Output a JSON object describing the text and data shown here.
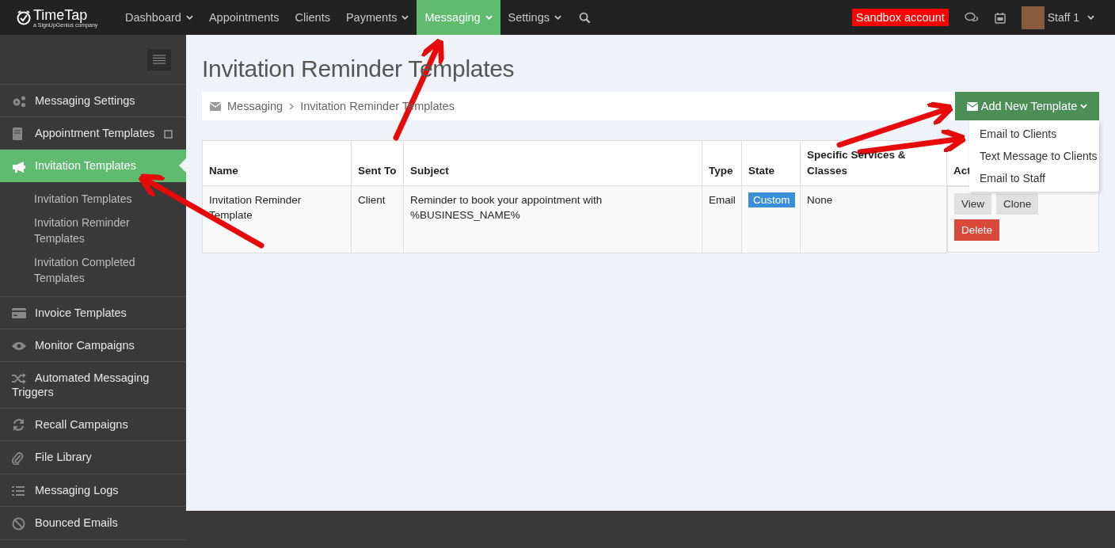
{
  "topbar": {
    "logo": "TimeTap",
    "logo_tagline": "a SignUpGenius company",
    "nav": [
      {
        "label": "Dashboard",
        "has_menu": true,
        "selected": false
      },
      {
        "label": "Appointments",
        "has_menu": false,
        "selected": false
      },
      {
        "label": "Clients",
        "has_menu": false,
        "selected": false
      },
      {
        "label": "Payments",
        "has_menu": true,
        "selected": false
      },
      {
        "label": "Messaging",
        "has_menu": true,
        "selected": true
      },
      {
        "label": "Settings",
        "has_menu": true,
        "selected": false
      }
    ],
    "sandbox_badge": "Sandbox account",
    "user": "Staff 1"
  },
  "sidebar": {
    "items": [
      {
        "label": "Messaging Settings",
        "selected": false
      },
      {
        "label": "Appointment Templates",
        "selected": false
      },
      {
        "label": "Invitation Templates",
        "selected": true,
        "children": [
          {
            "label": "Invitation Templates"
          },
          {
            "label": "Invitation Reminder Templates"
          },
          {
            "label": "Invitation Completed Templates"
          }
        ]
      },
      {
        "label": "Invoice Templates",
        "selected": false
      },
      {
        "label": "Monitor Campaigns",
        "selected": false
      },
      {
        "label": "Automated Messaging Triggers",
        "selected": false
      },
      {
        "label": "Recall Campaigns",
        "selected": false
      },
      {
        "label": "File Library",
        "selected": false
      },
      {
        "label": "Messaging Logs",
        "selected": false
      },
      {
        "label": "Bounced Emails",
        "selected": false
      }
    ]
  },
  "page": {
    "title": "Invitation Reminder Templates",
    "breadcrumb": [
      "Messaging",
      "Invitation Reminder Templates"
    ],
    "add_button": "Add New Template",
    "add_menu": [
      "Email to Clients",
      "Text Message to Clients",
      "Email to Staff"
    ]
  },
  "table": {
    "columns": [
      "Name",
      "Sent To",
      "Subject",
      "Type",
      "State",
      "Specific Services & Classes",
      "Act"
    ],
    "rows": [
      {
        "name": "Invitation Reminder Template",
        "sent_to": "Client",
        "subject": "Reminder to book your appointment with %BUSINESS_NAME%",
        "type": "Email",
        "state": "Custom",
        "services": "None",
        "actions": [
          {
            "label": "View",
            "kind": "default"
          },
          {
            "label": "Clone",
            "kind": "default"
          },
          {
            "label": "Delete",
            "kind": "danger"
          }
        ]
      }
    ]
  }
}
